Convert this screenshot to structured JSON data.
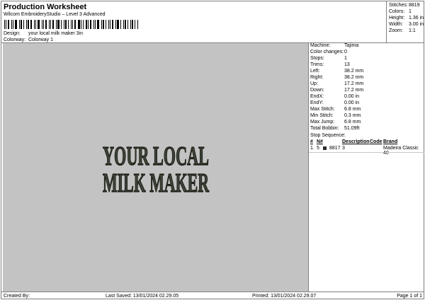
{
  "header": {
    "title": "Production Worksheet",
    "software": "Wilcom EmbroideryStudio – Level 3 Advanced",
    "design_label": "Design:",
    "design_value": "your local milk maker 3in",
    "colorway_label": "Colorway:",
    "colorway_value": "Colorway 1"
  },
  "stats": [
    {
      "label": "Stitches:",
      "value": "8819"
    },
    {
      "label": "Colors:",
      "value": "1"
    },
    {
      "label": "Height:",
      "value": "1.36 in"
    },
    {
      "label": "Width:",
      "value": "3.00 in"
    },
    {
      "label": "Zoom:",
      "value": "1:1"
    }
  ],
  "design_text": {
    "line1": "YOUR LOCAL",
    "line2": "MILK MAKER"
  },
  "machine_info": [
    {
      "label": "Machine:",
      "value": "Tajima"
    },
    {
      "label": "Color changes:",
      "value": "0"
    },
    {
      "label": "Stops:",
      "value": "1"
    },
    {
      "label": "Trims:",
      "value": "13"
    },
    {
      "label": "Left:",
      "value": "38.2 mm"
    },
    {
      "label": "Right:",
      "value": "38.2 mm"
    },
    {
      "label": "Up:",
      "value": "17.2 mm"
    },
    {
      "label": "Down:",
      "value": "17.2 mm"
    },
    {
      "label": "EndX:",
      "value": "0.00 in"
    },
    {
      "label": "EndY:",
      "value": "0.00 in"
    },
    {
      "label": "Max Stitch:",
      "value": "6.8 mm"
    },
    {
      "label": "Min Stitch:",
      "value": "0.3 mm"
    },
    {
      "label": "Max Jump:",
      "value": "6.8 mm"
    },
    {
      "label": "Total Bobbin:",
      "value": "51.09ft"
    }
  ],
  "stop_sequence": {
    "title": "Stop Sequence:",
    "columns": [
      "#",
      "N#",
      "Description",
      "Code",
      "Brand"
    ],
    "rows": [
      {
        "num": "1.",
        "n": "5",
        "stitches": "8817",
        "code": "3",
        "brand": "Madeira Classic 40",
        "color": "#2b2b2b"
      }
    ]
  },
  "footer": {
    "created_by": "Created By:",
    "last_saved": "Last Saved: 13/01/2024 02.29.05",
    "printed": "Printed: 13/01/2024 02.29.07",
    "page": "Page 1 of 1"
  },
  "colors": {
    "canvas": "#c3c3c3",
    "thread": "#3c4237",
    "thread_outline": "#15180f"
  }
}
